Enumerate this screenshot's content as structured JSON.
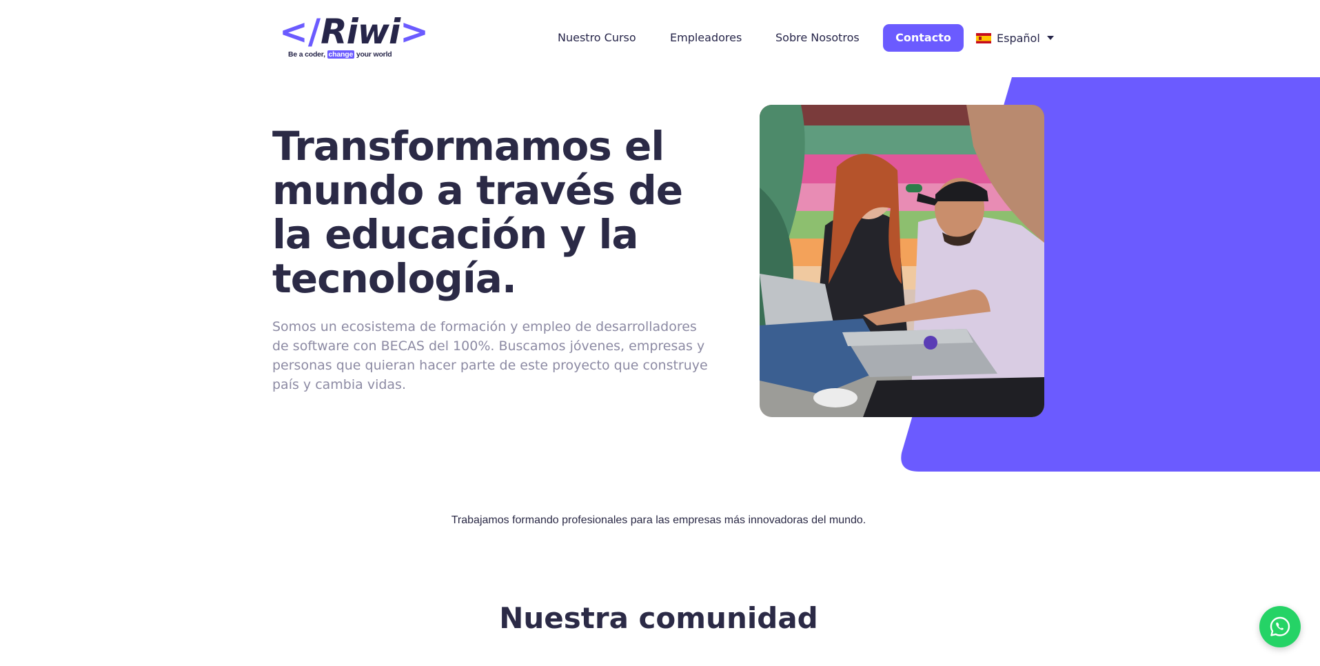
{
  "brand": {
    "bracket_left": "</",
    "name": "Riwi",
    "bracket_right": ">",
    "tagline_pre": "Be a coder,",
    "tagline_highlight": "change",
    "tagline_post": "your world"
  },
  "nav": {
    "items": [
      {
        "label": "Nuestro Curso"
      },
      {
        "label": "Empleadores"
      },
      {
        "label": "Sobre Nosotros"
      }
    ],
    "contact_label": "Contacto",
    "language": {
      "label": "Español",
      "flag_icon": "spain-flag-icon"
    }
  },
  "hero": {
    "title": "Transformamos el mundo a través de la educación y la tecnología.",
    "description": "Somos un ecosistema de formación y empleo de desarrolladores de software con BECAS del 100%. Buscamos jóvenes, empresas y personas que quieran hacer parte de este proyecto que construye país y cambia vidas."
  },
  "partners": {
    "text": "Trabajamos formando profesionales para las empresas más innovadoras del mundo."
  },
  "community": {
    "title": "Nuestra comunidad"
  },
  "colors": {
    "accent": "#6b5bff",
    "text_dark": "#2b2a46",
    "text_muted": "#8c8aa3",
    "whatsapp": "#25d366"
  },
  "floating": {
    "whatsapp_icon": "whatsapp-icon"
  }
}
